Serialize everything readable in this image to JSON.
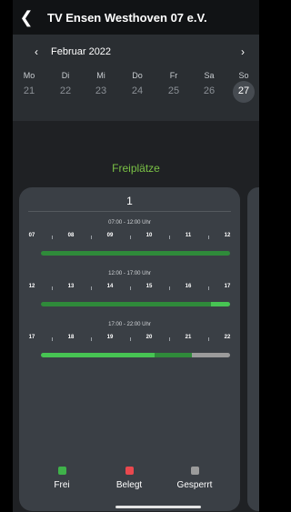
{
  "header": {
    "back_icon": "chevron-left-icon",
    "title": "TV Ensen Westhoven 07 e.V."
  },
  "calendar": {
    "month": "Februar 2022",
    "weekdays": [
      "Mo",
      "Di",
      "Mi",
      "Do",
      "Fr",
      "Sa",
      "So"
    ],
    "days": [
      "21",
      "22",
      "23",
      "24",
      "25",
      "26",
      "27"
    ],
    "selected_day": "27"
  },
  "section_title": "Freiplätze",
  "court": {
    "number": "1",
    "slots": [
      {
        "time": "07:00 - 12:00 Uhr",
        "hours": [
          "07",
          "08",
          "09",
          "10",
          "11",
          "12"
        ],
        "bar": [
          {
            "state": "frei",
            "fraction": 1.0
          }
        ]
      },
      {
        "time": "12:00 - 17:00 Uhr",
        "hours": [
          "12",
          "13",
          "14",
          "15",
          "16",
          "17"
        ],
        "bar": [
          {
            "state": "frei",
            "fraction": 0.9
          },
          {
            "state": "frei-highlight",
            "fraction": 0.1
          }
        ]
      },
      {
        "time": "17:00 - 22:00 Uhr",
        "hours": [
          "17",
          "18",
          "19",
          "20",
          "21",
          "22"
        ],
        "bar": [
          {
            "state": "frei-highlight",
            "fraction": 0.6
          },
          {
            "state": "frei",
            "fraction": 0.2
          },
          {
            "state": "gesperrt",
            "fraction": 0.2
          }
        ]
      }
    ]
  },
  "legend": [
    {
      "label": "Frei",
      "color": "#3fb24a"
    },
    {
      "label": "Belegt",
      "color": "#e9484e"
    },
    {
      "label": "Gesperrt",
      "color": "#9b9b9b"
    }
  ],
  "colors": {
    "frei": "#2f8a3a",
    "frei-highlight": "#47c453",
    "gesperrt": "#9b9b9b",
    "accent": "#79c045"
  }
}
